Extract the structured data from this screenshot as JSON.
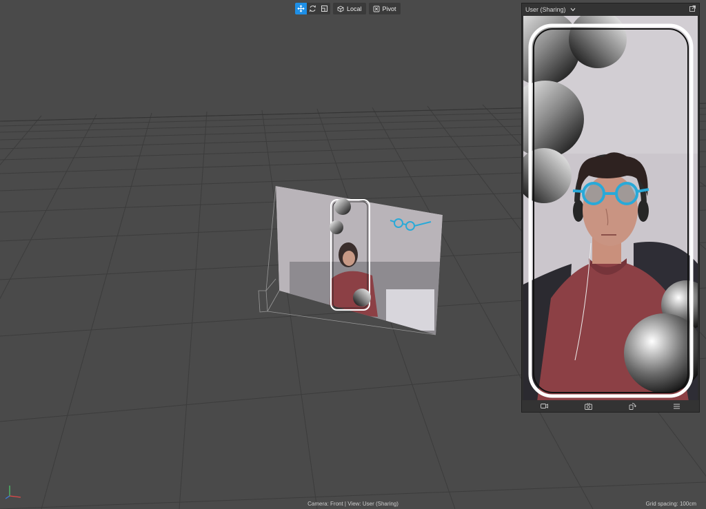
{
  "toolbar": {
    "tools": [
      {
        "name": "move-tool",
        "icon": "move-icon",
        "active": true
      },
      {
        "name": "rotate-tool",
        "icon": "rotate-icon",
        "active": false
      },
      {
        "name": "scale-tool",
        "icon": "scale-icon",
        "active": false
      }
    ],
    "space_label": "Local",
    "pivot_label": "Pivot"
  },
  "preview": {
    "title": "User (Sharing)",
    "header_icons": [
      "chevron-down-icon",
      "popout-icon"
    ],
    "footer_icons": [
      "record-icon",
      "capture-icon",
      "rotate-device-icon",
      "menu-icon"
    ]
  },
  "status": {
    "camera_text": "Camera: Front | View: User (Sharing)",
    "grid_spacing": "Grid spacing: 100cm"
  },
  "colors": {
    "background": "#4a4a4a",
    "grid_line": "#3b3b3b",
    "active_tool": "#1e8fe6",
    "glasses": "#29a9d8",
    "shirt": "#8c4045"
  }
}
